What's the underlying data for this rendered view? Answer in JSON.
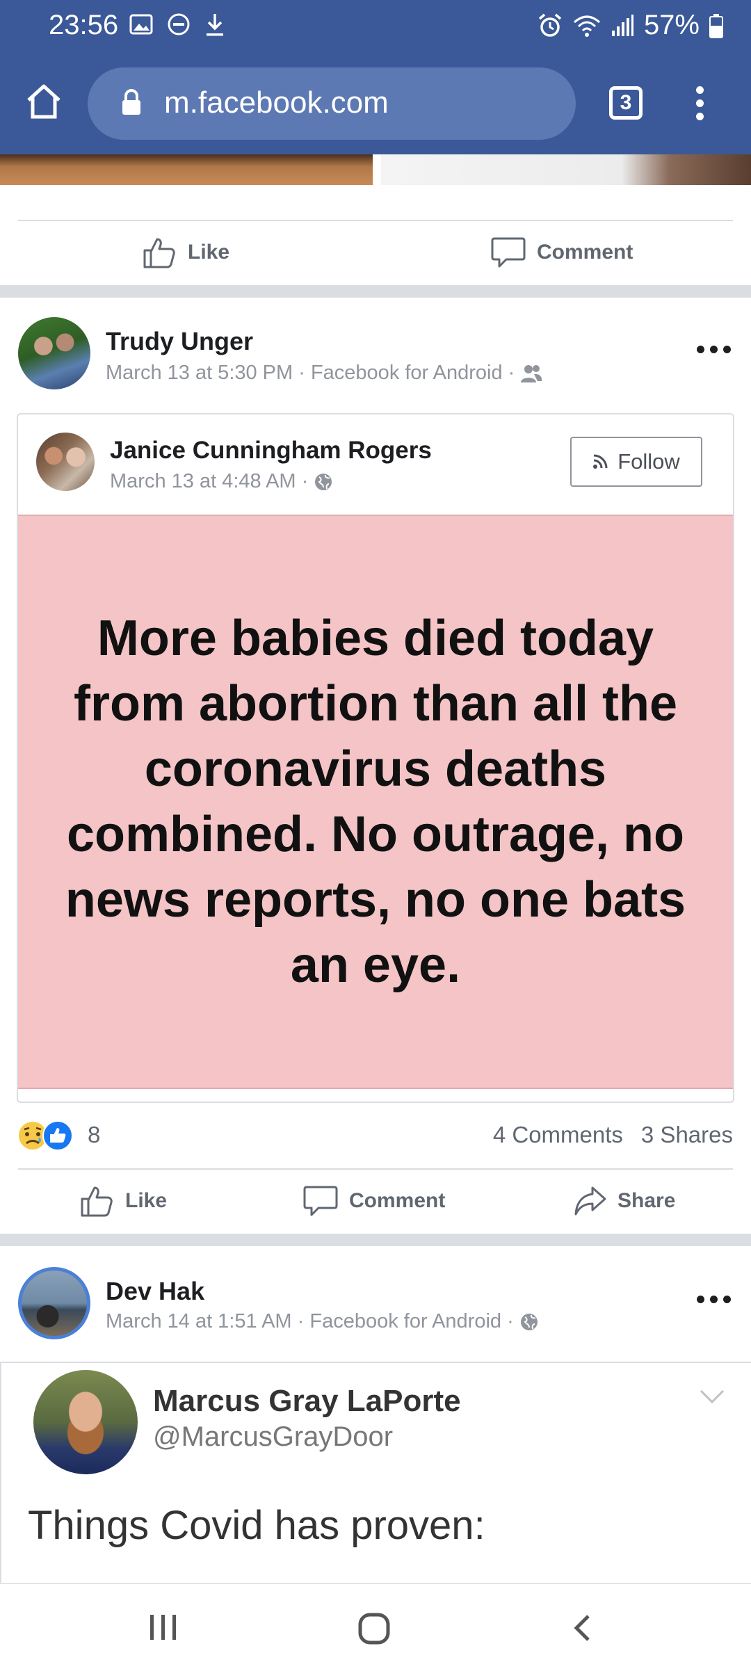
{
  "status_bar": {
    "time": "23:56",
    "battery": "57%",
    "icons": [
      "image-icon",
      "dnd-icon",
      "download-icon",
      "alarm-icon",
      "wifi-icon",
      "signal-icon",
      "battery-icon"
    ]
  },
  "browser": {
    "url": "m.facebook.com",
    "tab_count": "3"
  },
  "previous_post": {
    "like_label": "Like",
    "comment_label": "Comment"
  },
  "post1": {
    "author": "Trudy Unger",
    "meta": "March 13 at 5:30 PM · Facebook for Android ·",
    "privacy_icon": "friends-icon",
    "shared": {
      "author": "Janice Cunningham Rogers",
      "meta": "March 13 at 4:48 AM ·",
      "privacy_icon": "globe-icon",
      "follow_label": "Follow",
      "quote": "More babies died today from abortion than all the coronavirus deaths combined. No outrage, no news reports, no one bats an eye.",
      "quote_bg": "#f4c4c6"
    },
    "reactions": {
      "icons": [
        "sad-reaction-icon",
        "like-reaction-icon"
      ],
      "count": "8"
    },
    "comments": "4 Comments",
    "shares": "3 Shares",
    "like_label": "Like",
    "comment_label": "Comment",
    "share_label": "Share"
  },
  "post2": {
    "author": "Dev Hak",
    "meta": "March 14 at 1:51 AM · Facebook for Android ·",
    "privacy_icon": "globe-icon",
    "tweet": {
      "name": "Marcus Gray LaPorte",
      "handle": "@MarcusGrayDoor",
      "text": "Things Covid has proven:"
    }
  },
  "nav": [
    "recents-icon",
    "home-icon",
    "back-icon"
  ],
  "colors": {
    "brand": "#3b5998",
    "divider": "#dadde1",
    "meta": "#90949c"
  }
}
